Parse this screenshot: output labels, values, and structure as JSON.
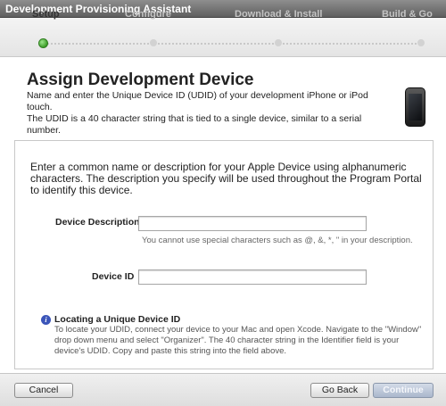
{
  "window": {
    "title": "Development Provisioning Assistant"
  },
  "steps": [
    {
      "label": "Setup",
      "active": true
    },
    {
      "label": "Configure",
      "active": false
    },
    {
      "label": "Download & Install",
      "active": false
    },
    {
      "label": "Build & Go",
      "active": false
    }
  ],
  "header": {
    "title": "Assign Development Device",
    "intro_line1": "Name and enter the Unique Device ID (UDID) of your development iPhone or iPod touch.",
    "intro_line2": "The UDID is a 40 character string that is tied to a single device, similar to a serial number.",
    "device_icon": "iphone-icon"
  },
  "form": {
    "description": "Enter a common name or description for your Apple Device using alphanumeric characters. The description you specify will be used throughout the Program Portal to identify this device.",
    "device_description_label": "Device Description",
    "device_description_value": "",
    "device_description_hint": "You cannot use special characters such as @, &, *, \" in your description.",
    "device_id_label": "Device ID",
    "device_id_value": ""
  },
  "info": {
    "icon": "info-icon",
    "title": "Locating a Unique Device ID",
    "body": "To locate your UDID, connect your device to your Mac and open Xcode. Navigate to the \"Window\" drop down menu and select \"Organizer\". The 40 character string in the Identifier field is your device's UDID. Copy and paste this string into the field above."
  },
  "footer": {
    "cancel_label": "Cancel",
    "back_label": "Go Back",
    "continue_label": "Continue"
  },
  "colors": {
    "active_step": "#3e9e2a",
    "info_icon": "#3b55b9",
    "primary_button": "#aab7cc"
  }
}
